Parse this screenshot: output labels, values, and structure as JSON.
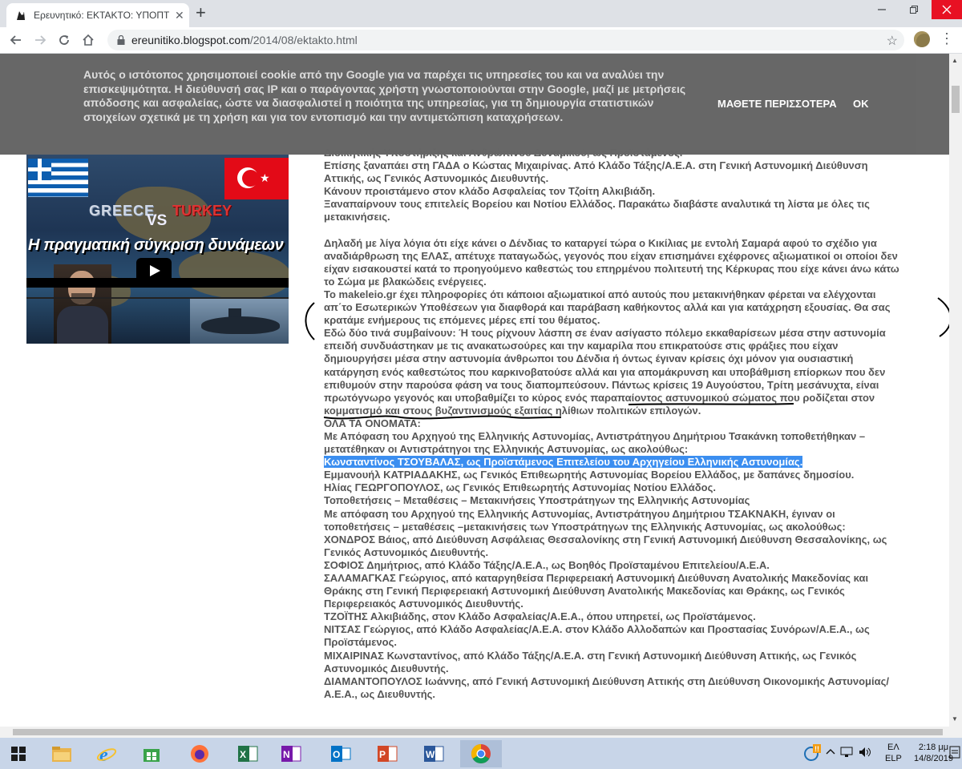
{
  "browser": {
    "tab_title": "Ερευνητικό: ΕΚΤΑΚΤΟ: ΥΠΟΠΤΕΣ",
    "url_host": "ereunitiko.blogspot.com",
    "url_path": "/2014/08/ektakto.html",
    "new_tab": "+",
    "tab_close": "✕"
  },
  "cookie_banner": {
    "text": "Αυτός ο ιστότοπος χρησιμοποιεί cookie από την Google για να παρέχει τις υπηρεσίες του και να αναλύει την επισκεψιμότητα. Η διεύθυνσή σας IP και ο παράγοντας χρήστη γνωστοποιούνται στην Google, μαζί με μετρήσεις απόδοσης και ασφαλείας, ώστε να διασφαλιστεί η ποιότητα της υπηρεσίας, για τη δημιουργία στατιστικών στοιχείων σχετικά με τη χρήση και για τον εντοπισμό και την αντιμετώπιση καταχρήσεων.",
    "learn_more": "ΜΑΘΕΤΕ ΠΕΡΙΣΣΟΤΕΡΑ",
    "ok": "OK"
  },
  "video": {
    "greece": "GREECE",
    "vs": "VS",
    "turkey": "TURKEY",
    "title": "Η πραγματική σύγκριση δυνάμεων"
  },
  "article": {
    "top_cut": "Διοικητικής Υποστήριξης και Ανθρώπινου Δυναμικού, ως Προϊστάμενος.",
    "lines": [
      "Επίσης ξαναπάει στη ΓΑΔΑ ο Κώστας Μιχαιρίνας. Από Κλάδο Τάξης/Α.Ε.Α. στη Γενική Αστυνομική Διεύθυνση",
      "Αττικής, ως Γενικός Αστυνομικός Διευθυντής.",
      "Κάνουν προιστάμενο στον κλάδο Ασφαλείας τον  Τζοίτη Αλκιβιάδη.",
      "Ξαναπαίρνουν τους επιτελείς Βορείου και Νοτίου Ελλάδος. Παρακάτω διαβάστε αναλυτικά τη λίστα με όλες τις",
      "μετακινήσεις.",
      "",
      "Δηλαδή με λίγα λόγια ότι είχε κάνει ο Δένδιας το καταργεί τώρα ο Κικίλιας με εντολή Σαμαρά αφού το σχέδιο για",
      "αναδιάρθρωση της ΕΛΑΣ, απέτυχε παταγωδώς, γεγονός που είχαν επισημάνει εχέφρονες αξιωματικοί οι οποίοι δεν",
      "είχαν εισακουστεί κατά το προηγούμενο καθεστώς του επηρμένου πολιτευτή της Κέρκυρας που είχε κάνει άνω κάτω",
      "το Σώμα με βλακώδεις ενέργειες.",
      "Το makeleio.gr  έχει πληροφορίες ότι κάποιοι αξιωματικοί από αυτούς που μετακινήθηκαν φέρεται να ελέγχονται",
      "απ΄το Εσωτερικών Υποθέσεων για διαφθορά  και παράβαση καθήκοντος αλλά και για κατάχρηση εξουσίας. Θα σας",
      "κρατάμε ενήμερους τις επόμενες μέρες επί του θέματος.",
      "Εδώ δύο τινά συμβαίνουν: Ή τους ρίχνουν λάσπη σε έναν ασίγαστο πόλεμο εκκαθαρίσεων μέσα στην αστυνομία",
      "επειδή συνδυάστηκαν με τις ανακατωσούρες και την καμαρίλα που επικρατούσε στις φράξιες που είχαν",
      "δημιουργήσει μέσα στην αστυνομία άνθρωποι του Δένδια ή όντως έγιναν κρίσεις όχι μόνον για ουσιαστική",
      "κατάργηση ενός καθεστώτος που καρκινοβατούσε αλλά και για απομάκρυνση και υποβάθμιση επίορκων που δεν",
      "επιθυμούν στην παρούσα φάση να τους διαπομπεύσουν. Πάντως κρίσεις 19 Αυγούστου, Τρίτη μεσάνυχτα, είναι",
      "πρωτόγνωρο γεγονός και υποβαθμίζει το κύρος ενός παραπαίοντος αστυνομικού σώματος που ροδίζεται στον",
      "κομματισμό και στους βυζαντινισμούς εξαιτίας ηλίθιων πολιτικών επιλογών.",
      "ΟΛΑ ΤΑ ΟΝΟΜΑΤΑ:",
      "Με Απόφαση του Αρχηγού της Ελληνικής Αστυνομίας, Αντιστράτηγου Δημήτριου Τσακάνκη τοποθετήθηκαν –",
      "μετατέθηκαν οι Αντιστράτηγοι της Ελληνικής Αστυνομίας, ως ακολούθως:"
    ],
    "highlight": "Κωνσταντίνος ΤΣΟΥΒΑΛΑΣ, ως Προϊστάμενος Επιτελείου του Αρχηγείου Ελληνικής Αστυνομίας.",
    "lines_after": [
      "Εμμανουήλ ΚΑΤΡΙΑΔΑΚΗΣ, ως Γενικός Επιθεωρητής Αστυνομίας Βορείου Ελλάδος, με δαπάνες δημοσίου.",
      "Ηλίας ΓΕΩΡΓΟΠΟΥΛΟΣ, ως Γενικός Επιθεωρητής Αστυνομίας Νοτίου Ελλάδος.",
      "Τοποθετήσεις – Μεταθέσεις – Μετακινήσεις Υποστράτηγων της Ελληνικής Αστυνομίας",
      " Με απόφαση του Αρχηγού της Ελληνικής Αστυνομίας, Αντιστράτηγου Δημήτριου ΤΣΑΚΝΑΚΗ, έγιναν οι",
      "τοποθετήσεις – μεταθέσεις –μετακινήσεις των Υποστράτηγων της Ελληνικής Αστυνομίας, ως ακολούθως:",
      "ΧΟΝΔΡΟΣ Βάιος, από Διεύθυνση Ασφάλειας Θεσσαλονίκης στη Γενική Αστυνομική Διεύθυνση Θεσσαλονίκης, ως",
      "Γενικός Αστυνομικός Διευθυντής.",
      "ΣΟΦΙΟΣ Δημήτριος, από Κλάδο Τάξης/Α.Ε.Α., ως Βοηθός Προϊσταμένου Επιτελείου/Α.Ε.Α.",
      "ΣΑΛΑΜΑΓΚΑΣ Γεώργιος, από καταργηθείσα Περιφερειακή Αστυνομική Διεύθυνση Ανατολικής Μακεδονίας και",
      "Θράκης στη Γενική Περιφερειακή Αστυνομική Διεύθυνση Ανατολικής Μακεδονίας και Θράκης, ως Γενικός",
      "Περιφερειακός Αστυνομικός Διευθυντής.",
      "ΤΖΟΪΤΗΣ Αλκιβιάδης, στον Κλάδο Ασφαλείας/Α.Ε.Α., όπου υπηρετεί, ως Προϊστάμενος.",
      "ΝΙΤΣΑΣ Γεώργιος, από Κλάδο Ασφαλείας/Α.Ε.Α. στον Κλάδο Αλλοδαπών και Προστασίας Συνόρων/Α.Ε.Α., ως",
      "Προϊστάμενος.",
      "ΜΙΧΑΙΡΙΝΑΣ Κωνσταντίνος, από Κλάδο Τάξης/Α.Ε.Α. στη Γενική Αστυνομική Διεύθυνση Αττικής, ως Γενικός",
      "Αστυνομικός Διευθυντής.",
      "ΔΙΑΜΑΝΤΟΠΟΥΛΟΣ Ιωάννης, από Γενική Αστυνομική Διεύθυνση Αττικής στη Διεύθυνση Οικονομικής Αστυνομίας/",
      "Α.Ε.Α., ως Διευθυντής."
    ]
  },
  "taskbar": {
    "lang_top": "ΕΛ",
    "lang_bottom": "ELP",
    "time": "2:18 μμ",
    "date": "14/8/2019"
  }
}
